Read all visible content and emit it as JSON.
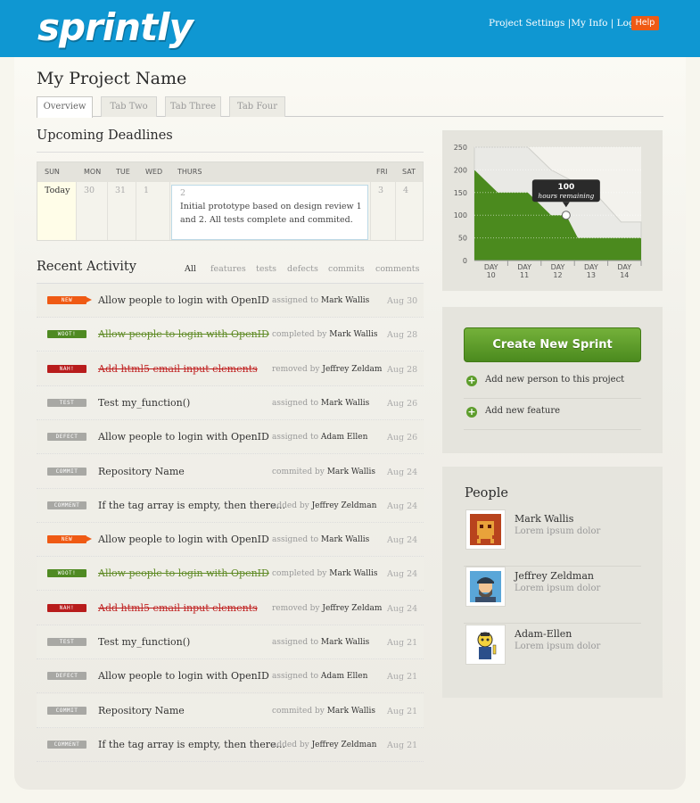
{
  "header": {
    "logo": "sprintly",
    "nav": [
      "Project Settings",
      "My Info",
      "Log-out"
    ],
    "nav_sep": "|",
    "help": "Help"
  },
  "project": {
    "title": "My Project Name"
  },
  "tabs": [
    "Overview",
    "Tab Two",
    "Tab Three",
    "Tab Four"
  ],
  "deadlines": {
    "title": "Upcoming Deadlines",
    "days": [
      "SUN",
      "MON",
      "TUE",
      "WED",
      "THURS",
      "FRI",
      "SAT"
    ],
    "dates": [
      "Today",
      "30",
      "31",
      "1",
      "2",
      "3",
      "4"
    ],
    "highlight_text": "Initial prototype based on design review 1 and 2. All tests complete and commited."
  },
  "activity": {
    "title": "Recent Activity",
    "filters": [
      "All",
      "features",
      "tests",
      "defects",
      "commits",
      "comments"
    ],
    "items": [
      {
        "badge": "NEW",
        "title": "Allow people to login with OpenID",
        "verb": "assigned to",
        "who": "Mark Wallis",
        "date": "Aug 30"
      },
      {
        "badge": "WOOT!",
        "title": "Allow people to login with OpenID",
        "verb": "completed by",
        "who": "Mark Wallis",
        "date": "Aug 28"
      },
      {
        "badge": "NAH!",
        "title": "Add html5 email input elements",
        "verb": "removed by",
        "who": "Jeffrey Zeldam",
        "date": "Aug 28"
      },
      {
        "badge": "TEST",
        "title": "Test my_function()",
        "verb": "assigned to",
        "who": "Mark Wallis",
        "date": "Aug 26"
      },
      {
        "badge": "DEFECT",
        "title": "Allow people to login with OpenID",
        "verb": "assigned to",
        "who": "Adam Ellen",
        "date": "Aug 26"
      },
      {
        "badge": "COMMIT",
        "title": "Repository Name",
        "verb": "commited by",
        "who": "Mark Wallis",
        "date": "Aug 24"
      },
      {
        "badge": "COMMENT",
        "title": "If the tag array is empty, then there...",
        "verb": "added by",
        "who": "Jeffrey Zeldman",
        "date": "Aug 24"
      },
      {
        "badge": "NEW",
        "title": "Allow people to login with OpenID",
        "verb": "assigned to",
        "who": "Mark Wallis",
        "date": "Aug 24"
      },
      {
        "badge": "WOOT!",
        "title": "Allow people to login with OpenID",
        "verb": "completed by",
        "who": "Mark Wallis",
        "date": "Aug 24"
      },
      {
        "badge": "NAH!",
        "title": "Add html5 email input elements",
        "verb": "removed by",
        "who": "Jeffrey Zeldam",
        "date": "Aug 24"
      },
      {
        "badge": "TEST",
        "title": "Test my_function()",
        "verb": "assigned to",
        "who": "Mark Wallis",
        "date": "Aug 21"
      },
      {
        "badge": "DEFECT",
        "title": "Allow people to login with OpenID",
        "verb": "assigned to",
        "who": "Adam Ellen",
        "date": "Aug 21"
      },
      {
        "badge": "COMMIT",
        "title": "Repository Name",
        "verb": "commited by",
        "who": "Mark Wallis",
        "date": "Aug 21"
      },
      {
        "badge": "COMMENT",
        "title": "If the tag array is empty, then there...",
        "verb": "added by",
        "who": "Jeffrey Zeldman",
        "date": "Aug 21"
      }
    ]
  },
  "badge_colors": {
    "NEW": "#ef5a14",
    "WOOT!": "#4f8a22",
    "NAH!": "#b81c1c",
    "TEST": "#a8a8a4",
    "DEFECT": "#a8a8a4",
    "COMMIT": "#a8a8a4",
    "COMMENT": "#a8a8a4"
  },
  "chart_data": {
    "type": "area",
    "categories": [
      "DAY\n10",
      "DAY\n11",
      "DAY\n12",
      "DAY\n13",
      "DAY\n14"
    ],
    "yticks": [
      0,
      50,
      100,
      150,
      200,
      250
    ],
    "ylim": [
      0,
      250
    ],
    "ideal": [
      [
        0,
        250
      ],
      [
        1.6,
        250
      ],
      [
        2.3,
        200
      ],
      [
        3.6,
        150
      ],
      [
        4.4,
        85
      ],
      [
        5,
        85
      ]
    ],
    "actual": [
      [
        0,
        200
      ],
      [
        0.7,
        150
      ],
      [
        1.6,
        150
      ],
      [
        2.3,
        100
      ],
      [
        2.75,
        100
      ],
      [
        3.1,
        50
      ],
      [
        5,
        50
      ]
    ],
    "tooltip": {
      "value": "100",
      "label": "hours remaining",
      "x": 2.75,
      "y": 100
    }
  },
  "actions": {
    "create": "Create New Sprint",
    "links": [
      "Add new person to this project",
      "Add new feature"
    ]
  },
  "people": {
    "title": "People",
    "list": [
      {
        "name": "Mark Wallis",
        "sub": "Lorem ipsum dolor"
      },
      {
        "name": "Jeffrey Zeldman",
        "sub": "Lorem ipsum dolor"
      },
      {
        "name": "Adam-Ellen",
        "sub": "Lorem ipsum dolor"
      }
    ]
  },
  "colors": {
    "header": "#0f97d2",
    "chart_actual": "#4b8a1e",
    "chart_ideal": "#e9e9e5"
  }
}
